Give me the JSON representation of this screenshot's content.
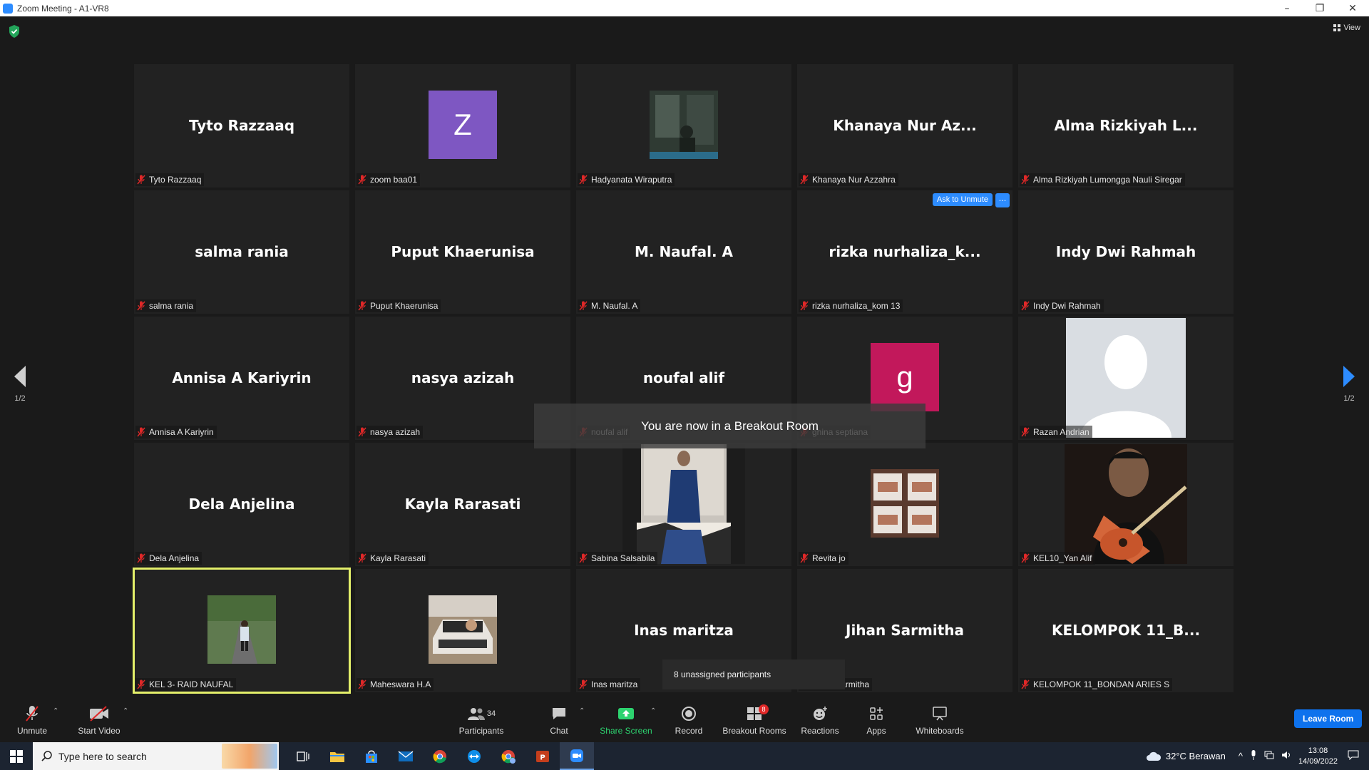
{
  "window": {
    "title": "Zoom Meeting - A1-VR8"
  },
  "top": {
    "view_label": "View"
  },
  "nav": {
    "left_page": "1/2",
    "right_page": "1/2"
  },
  "tiles": [
    {
      "big": "Tyto Razzaaq",
      "label": "Tyto Razzaaq"
    },
    {
      "letter": "Z",
      "letter_color": "#7e57c2",
      "label": "zoom baa01"
    },
    {
      "photo": "dark-room-photo",
      "label": "Hadyanata Wiraputra"
    },
    {
      "big": "Khanaya Nur Az...",
      "label": "Khanaya Nur Azzahra"
    },
    {
      "big": "Alma Rizkiyah L...",
      "label": "Alma Rizkiyah Lumongga Nauli Siregar"
    },
    {
      "big": "salma rania",
      "label": "salma rania"
    },
    {
      "big": "Puput Khaerunisa",
      "label": "Puput Khaerunisa"
    },
    {
      "big": "M. Naufal. A",
      "label": "M. Naufal. A"
    },
    {
      "big": "rizka nurhaliza_k...",
      "label": "rizka nurhaliza_kom 13",
      "ask": "Ask to Unmute",
      "more": "···"
    },
    {
      "big": "Indy Dwi Rahmah",
      "label": "Indy Dwi Rahmah"
    },
    {
      "big": "Annisa A Kariyrin",
      "label": "Annisa A Kariyrin"
    },
    {
      "big": "nasya azizah",
      "label": "nasya azizah"
    },
    {
      "big": "noufal alif",
      "label": "noufal alif"
    },
    {
      "letter": "g",
      "letter_color": "#c2185b",
      "label": "ghina septiana"
    },
    {
      "photo": "default-avatar",
      "label": "Razan Andrian"
    },
    {
      "big": "Dela Anjelina",
      "label": "Dela Anjelina"
    },
    {
      "big": "Kayla Rarasati",
      "label": "Kayla Rarasati"
    },
    {
      "photo": "fashion-photo",
      "label": "Sabina Salsabila"
    },
    {
      "photo": "collage-photo",
      "label": "Revita jo"
    },
    {
      "photo": "guitar-photo",
      "label": "KEL10_Yan Alif"
    },
    {
      "photo": "road-photo",
      "label": "KEL 3- RAID NAUFAL",
      "active": true
    },
    {
      "photo": "car-photo",
      "label": "Maheswara H.A"
    },
    {
      "big": "Inas maritza",
      "label": "Inas maritza"
    },
    {
      "big": "Jihan Sarmitha",
      "label": "Jihan Sarmitha"
    },
    {
      "big": "KELOMPOK 11_B...",
      "label": "KELOMPOK 11_BONDAN ARIES S"
    }
  ],
  "toast": {
    "text": "You are now in a Breakout Room"
  },
  "tooltip": {
    "text": "8 unassigned participants"
  },
  "toolbar": {
    "unmute": "Unmute",
    "start_video": "Start Video",
    "participants": "Participants",
    "participants_count": "34",
    "chat": "Chat",
    "share_screen": "Share Screen",
    "record": "Record",
    "breakout": "Breakout Rooms",
    "breakout_badge": "8",
    "reactions": "Reactions",
    "apps": "Apps",
    "whiteboards": "Whiteboards",
    "leave": "Leave Room"
  },
  "taskbar": {
    "search_placeholder": "Type here to search",
    "weather": "32°C  Berawan",
    "time": "13:08",
    "date": "14/09/2022"
  },
  "colors": {
    "accent": "#2d8cff",
    "active_speaker": "#e4f06a",
    "share_green": "#2dd36f",
    "mute_red": "#e02828"
  }
}
